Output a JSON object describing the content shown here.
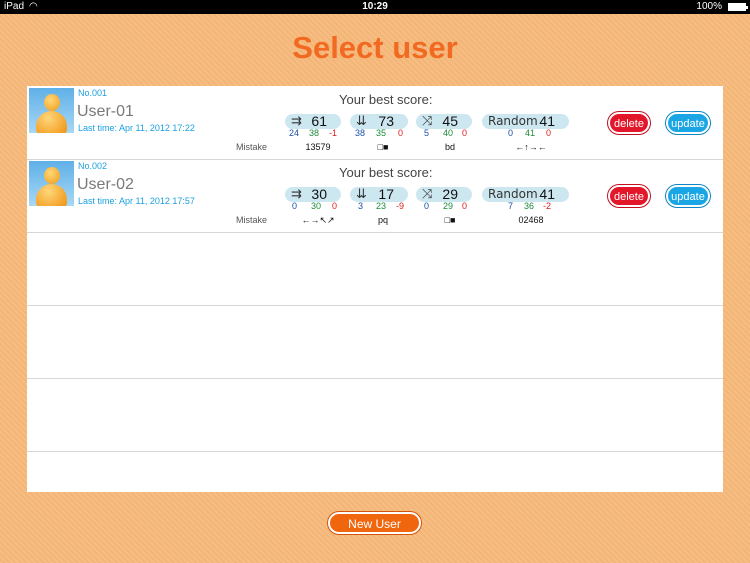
{
  "status_bar": {
    "carrier": "iPad",
    "wifi_icon": "wifi-icon",
    "time": "10:29",
    "battery": "100%",
    "battery_icon": "battery-icon"
  },
  "title": "Select user",
  "best_score_label": "Your best score:",
  "mistake_label": "Mistake",
  "delete_label": "delete",
  "update_label": "update",
  "new_user_label": "New User",
  "colors": {
    "background": "#f7b97a",
    "title": "#f26a22",
    "accent_blue": "#1aa0e0",
    "delete_red": "#e3172a",
    "update_blue": "#1aa6e4",
    "new_user_orange": "#f0660f"
  },
  "users": [
    {
      "no": "No.001",
      "name": "User-01",
      "last_time": "Last time: Apr 11, 2012 17:22",
      "scores": [
        {
          "mode": "⇉",
          "value": "61",
          "stats": [
            "24",
            "38",
            "-1"
          ],
          "mistake": "13579"
        },
        {
          "mode": "⇊",
          "value": "73",
          "stats": [
            "38",
            "35",
            "0"
          ],
          "mistake": "□■"
        },
        {
          "mode": "⤨",
          "value": "45",
          "stats": [
            "5",
            "40",
            "0"
          ],
          "mistake": "bd"
        },
        {
          "mode": "Random",
          "value": "41",
          "stats": [
            "0",
            "41",
            "0"
          ],
          "mistake": "←↑→←"
        }
      ]
    },
    {
      "no": "No.002",
      "name": "User-02",
      "last_time": "Last time: Apr 11, 2012 17:57",
      "scores": [
        {
          "mode": "⇉",
          "value": "30",
          "stats": [
            "0",
            "30",
            "0"
          ],
          "mistake": "←→↖↗"
        },
        {
          "mode": "⇊",
          "value": "17",
          "stats": [
            "3",
            "23",
            "-9"
          ],
          "mistake": "pq"
        },
        {
          "mode": "⤨",
          "value": "29",
          "stats": [
            "0",
            "29",
            "0"
          ],
          "mistake": "□■"
        },
        {
          "mode": "Random",
          "value": "41",
          "stats": [
            "7",
            "36",
            "-2"
          ],
          "mistake": "02468"
        }
      ]
    }
  ]
}
